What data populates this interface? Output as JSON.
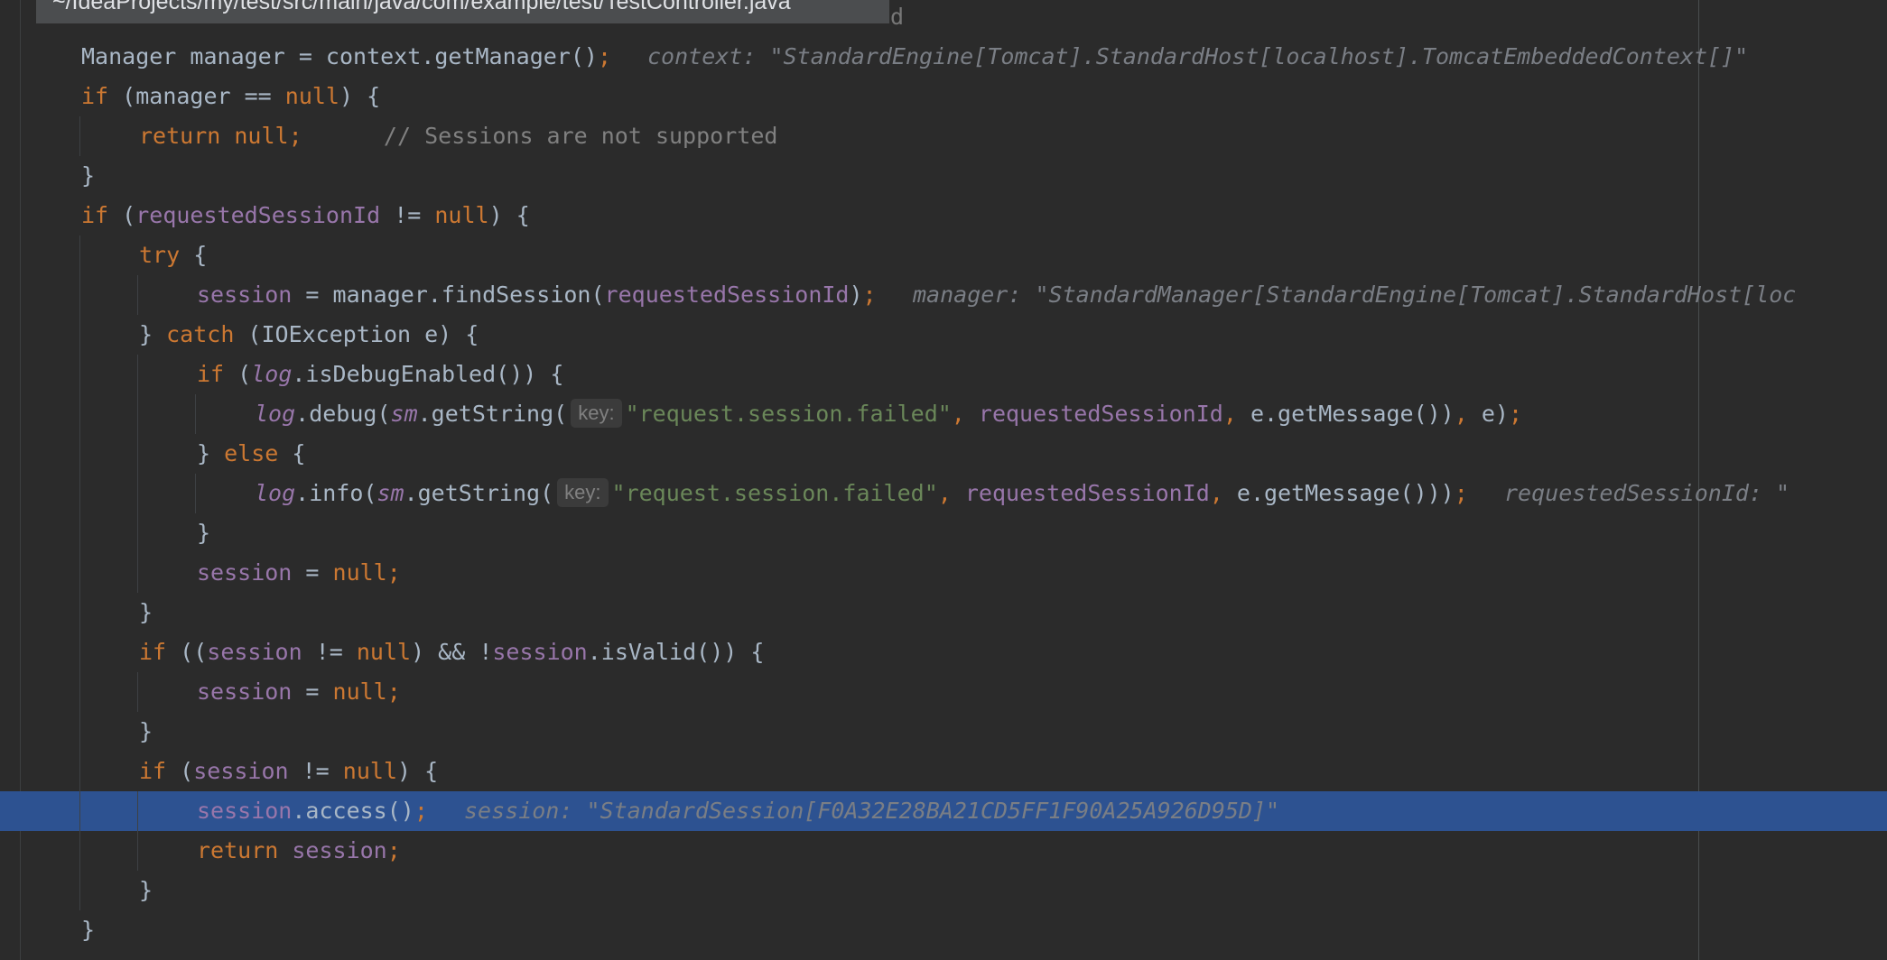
{
  "editor": {
    "file_path": "~/IdeaProjects/my/test/src/main/java/com/example/test/TestController.java",
    "tooltip_tail": "d",
    "lines": [
      {
        "indent": 1,
        "tokens": [
          {
            "t": "Manager manager = context.getManager()",
            "c": "plain"
          },
          {
            "t": ";",
            "c": "kw"
          }
        ],
        "hint": "context: \"StandardEngine[Tomcat].StandardHost[localhost].TomcatEmbeddedContext[]\""
      },
      {
        "indent": 1,
        "tokens": [
          {
            "t": "if",
            "c": "kw"
          },
          {
            "t": " (manager == ",
            "c": "plain"
          },
          {
            "t": "null",
            "c": "kw"
          },
          {
            "t": ") {",
            "c": "plain"
          }
        ]
      },
      {
        "indent": 2,
        "tokens": [
          {
            "t": "return null;",
            "c": "kw"
          },
          {
            "t": "      // Sessions are not supported",
            "c": "cmt"
          }
        ]
      },
      {
        "indent": 1,
        "tokens": [
          {
            "t": "}",
            "c": "plain"
          }
        ]
      },
      {
        "indent": 1,
        "tokens": [
          {
            "t": "if",
            "c": "kw"
          },
          {
            "t": " (",
            "c": "plain"
          },
          {
            "t": "requestedSessionId",
            "c": "var"
          },
          {
            "t": " != ",
            "c": "plain"
          },
          {
            "t": "null",
            "c": "kw"
          },
          {
            "t": ") {",
            "c": "plain"
          }
        ]
      },
      {
        "indent": 2,
        "tokens": [
          {
            "t": "try",
            "c": "kw"
          },
          {
            "t": " {",
            "c": "plain"
          }
        ]
      },
      {
        "indent": 3,
        "tokens": [
          {
            "t": "session",
            "c": "var"
          },
          {
            "t": " = manager.findSession(",
            "c": "plain"
          },
          {
            "t": "requestedSessionId",
            "c": "var"
          },
          {
            "t": ")",
            "c": "plain"
          },
          {
            "t": ";",
            "c": "kw"
          }
        ],
        "hint": "manager: \"StandardManager[StandardEngine[Tomcat].StandardHost[loc"
      },
      {
        "indent": 2,
        "tokens": [
          {
            "t": "} ",
            "c": "plain"
          },
          {
            "t": "catch",
            "c": "kw"
          },
          {
            "t": " (IOException e) {",
            "c": "plain"
          }
        ]
      },
      {
        "indent": 3,
        "tokens": [
          {
            "t": "if",
            "c": "kw"
          },
          {
            "t": " (",
            "c": "plain"
          },
          {
            "t": "log",
            "c": "static"
          },
          {
            "t": ".isDebugEnabled()) {",
            "c": "plain"
          }
        ]
      },
      {
        "indent": 4,
        "tokens": [
          {
            "t": "log",
            "c": "static"
          },
          {
            "t": ".debug(",
            "c": "plain"
          },
          {
            "t": "sm",
            "c": "static"
          },
          {
            "t": ".getString(",
            "c": "plain"
          },
          {
            "t": "key:",
            "c": "param"
          },
          {
            "t": "\"request.session.failed\"",
            "c": "str"
          },
          {
            "t": ", ",
            "c": "kw"
          },
          {
            "t": "requestedSessionId",
            "c": "var"
          },
          {
            "t": ", ",
            "c": "kw"
          },
          {
            "t": "e.getMessage())",
            "c": "plain"
          },
          {
            "t": ", ",
            "c": "kw"
          },
          {
            "t": "e)",
            "c": "plain"
          },
          {
            "t": ";",
            "c": "kw"
          }
        ]
      },
      {
        "indent": 3,
        "tokens": [
          {
            "t": "} ",
            "c": "plain"
          },
          {
            "t": "else",
            "c": "kw"
          },
          {
            "t": " {",
            "c": "plain"
          }
        ]
      },
      {
        "indent": 4,
        "tokens": [
          {
            "t": "log",
            "c": "static"
          },
          {
            "t": ".info(",
            "c": "plain"
          },
          {
            "t": "sm",
            "c": "static"
          },
          {
            "t": ".getString(",
            "c": "plain"
          },
          {
            "t": "key:",
            "c": "param"
          },
          {
            "t": "\"request.session.failed\"",
            "c": "str"
          },
          {
            "t": ", ",
            "c": "kw"
          },
          {
            "t": "requestedSessionId",
            "c": "var"
          },
          {
            "t": ", ",
            "c": "kw"
          },
          {
            "t": "e.getMessage()))",
            "c": "plain"
          },
          {
            "t": ";",
            "c": "kw"
          }
        ],
        "hint": "requestedSessionId: \""
      },
      {
        "indent": 3,
        "tokens": [
          {
            "t": "}",
            "c": "plain"
          }
        ]
      },
      {
        "indent": 3,
        "tokens": [
          {
            "t": "session",
            "c": "var"
          },
          {
            "t": " = ",
            "c": "plain"
          },
          {
            "t": "null;",
            "c": "kw"
          }
        ]
      },
      {
        "indent": 2,
        "tokens": [
          {
            "t": "}",
            "c": "plain"
          }
        ]
      },
      {
        "indent": 2,
        "tokens": [
          {
            "t": "if",
            "c": "kw"
          },
          {
            "t": " ((",
            "c": "plain"
          },
          {
            "t": "session",
            "c": "var"
          },
          {
            "t": " != ",
            "c": "plain"
          },
          {
            "t": "null",
            "c": "kw"
          },
          {
            "t": ") && !",
            "c": "plain"
          },
          {
            "t": "session",
            "c": "var"
          },
          {
            "t": ".isValid()) {",
            "c": "plain"
          }
        ]
      },
      {
        "indent": 3,
        "tokens": [
          {
            "t": "session",
            "c": "var"
          },
          {
            "t": " = ",
            "c": "plain"
          },
          {
            "t": "null;",
            "c": "kw"
          }
        ]
      },
      {
        "indent": 2,
        "tokens": [
          {
            "t": "}",
            "c": "plain"
          }
        ]
      },
      {
        "indent": 2,
        "tokens": [
          {
            "t": "if",
            "c": "kw"
          },
          {
            "t": " (",
            "c": "plain"
          },
          {
            "t": "session",
            "c": "var"
          },
          {
            "t": " != ",
            "c": "plain"
          },
          {
            "t": "null",
            "c": "kw"
          },
          {
            "t": ") {",
            "c": "plain"
          }
        ]
      },
      {
        "indent": 3,
        "current": true,
        "tokens": [
          {
            "t": "session",
            "c": "var"
          },
          {
            "t": ".access()",
            "c": "plain"
          },
          {
            "t": ";",
            "c": "kw"
          }
        ],
        "hint": "session: \"StandardSession[F0A32E28BA21CD5FF1F90A25A926D95D]\""
      },
      {
        "indent": 3,
        "tokens": [
          {
            "t": "return",
            "c": "kw"
          },
          {
            "t": " ",
            "c": "plain"
          },
          {
            "t": "session",
            "c": "var"
          },
          {
            "t": ";",
            "c": "kw"
          }
        ]
      },
      {
        "indent": 2,
        "tokens": [
          {
            "t": "}",
            "c": "plain"
          }
        ]
      },
      {
        "indent": 1,
        "tokens": [
          {
            "t": "}",
            "c": "plain"
          }
        ]
      }
    ]
  }
}
